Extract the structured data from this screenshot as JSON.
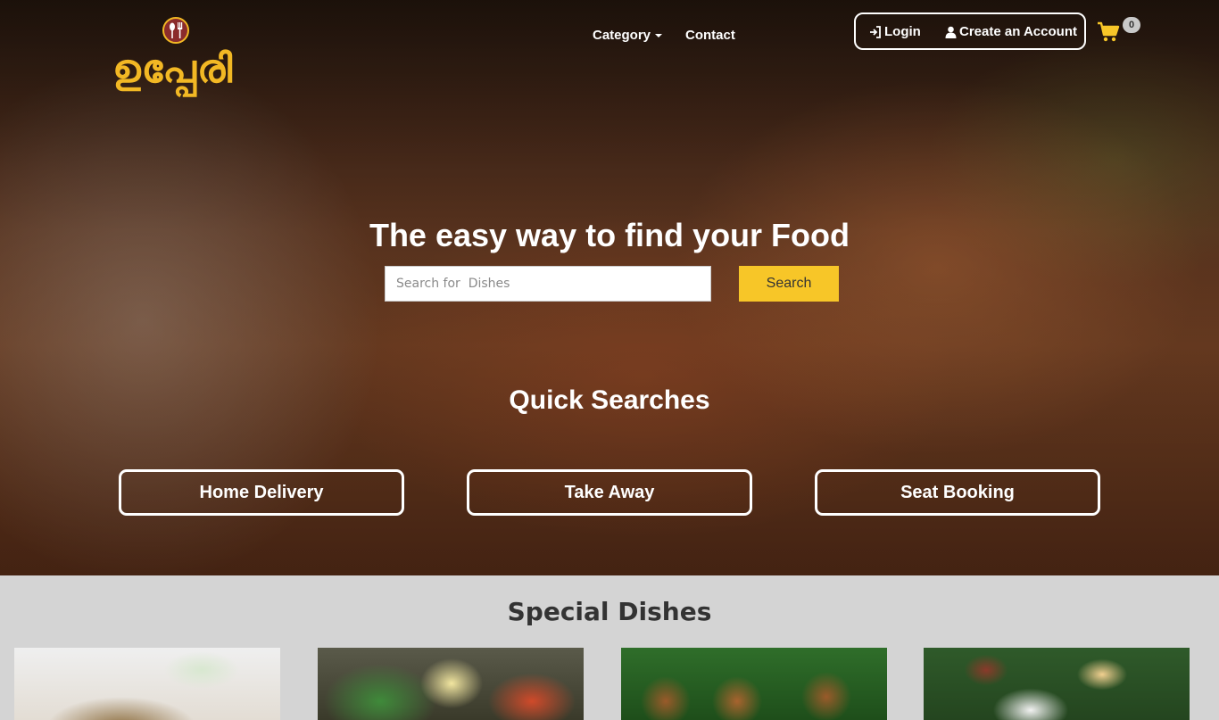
{
  "brand": {
    "logo_text": "ഉപ്പേരി",
    "logo_icon": "fork-spoon-icon",
    "accent_color": "#f2b824",
    "logo_badge_color": "#8b2c2c"
  },
  "nav": {
    "category_label": "Category",
    "contact_label": "Contact",
    "login_label": "Login",
    "login_icon": "log-in-icon",
    "create_account_label": "Create an Account",
    "create_account_icon": "user-icon",
    "cart_icon": "shopping-cart-icon",
    "cart_count": "0",
    "cart_color": "#f7c628"
  },
  "hero": {
    "headline": "The easy way to find your Food",
    "search": {
      "placeholder": "Search for  Dishes",
      "value": "",
      "button_label": "Search",
      "button_color": "#f7c628"
    },
    "quick_searches_title": "Quick Searches",
    "quick_searches": [
      {
        "label": "Home Delivery"
      },
      {
        "label": "Take Away"
      },
      {
        "label": "Seat Booking"
      }
    ]
  },
  "special": {
    "title": "Special Dishes",
    "dishes": [
      {
        "image": "biryani-salad-photo"
      },
      {
        "image": "tandoori-salad-photo"
      },
      {
        "image": "skewers-on-leaf-photo"
      },
      {
        "image": "kerala-sadya-photo"
      }
    ]
  }
}
